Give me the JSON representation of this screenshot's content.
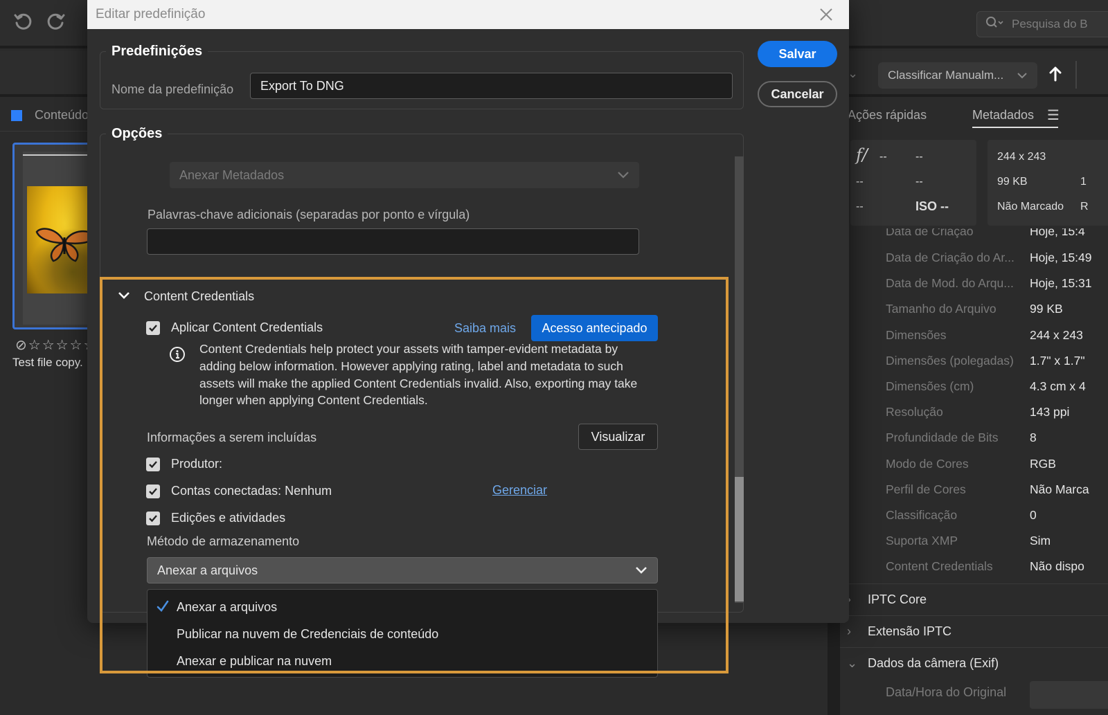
{
  "app": {
    "undo_icon": "undo-icon",
    "redo_icon": "redo-icon",
    "search_placeholder": "Pesquisa do B",
    "sort_label": "Classificar Manualm...",
    "sort_direction_icon": "arrow-up-icon",
    "left_panel": {
      "header_label": "Conteúdo",
      "thumbnail": {
        "name": "Test file copy.",
        "rating": 0,
        "rating_max": 5
      }
    },
    "right_panel": {
      "tabs": [
        {
          "label": "Ações rápidas",
          "active": false
        },
        {
          "label": "Metadados",
          "active": true
        }
      ],
      "exif_summary": {
        "fstop": "f/",
        "fstop_value": "--",
        "shutter": "--",
        "focal": "--",
        "exposure": "--",
        "flash": "--",
        "iso": "ISO --"
      },
      "file_summary": {
        "dimensions": "244 x 243",
        "size": "99 KB",
        "size_extra": "1",
        "label": "Não Marcado",
        "label_extra": "R"
      },
      "metadata_rows": [
        {
          "key": "Data de Criação",
          "value": "Hoje, 15:4"
        },
        {
          "key": "Data de Criação do Ar...",
          "value": "Hoje, 15:49"
        },
        {
          "key": "Data de Mod. do Arqu...",
          "value": "Hoje, 15:31"
        },
        {
          "key": "Tamanho do Arquivo",
          "value": "99 KB"
        },
        {
          "key": "Dimensões",
          "value": "244 x 243"
        },
        {
          "key": "Dimensões (polegadas)",
          "value": "1.7\" x 1.7\""
        },
        {
          "key": "Dimensões (cm)",
          "value": "4.3 cm x 4"
        },
        {
          "key": "Resolução",
          "value": "143 ppi"
        },
        {
          "key": "Profundidade de Bits",
          "value": "8"
        },
        {
          "key": "Modo de Cores",
          "value": "RGB"
        },
        {
          "key": "Perfil de Cores",
          "value": "Não Marca"
        },
        {
          "key": "Classificação",
          "value": "0"
        },
        {
          "key": "Suporta XMP",
          "value": "Sim"
        },
        {
          "key": "Content Credentials",
          "value": "Não dispo"
        }
      ],
      "sections": [
        {
          "label": "IPTC Core",
          "expanded": false
        },
        {
          "label": "Extensão IPTC",
          "expanded": false
        },
        {
          "label": "Dados da câmera (Exif)",
          "expanded": true
        }
      ],
      "exif_first_row": "Data/Hora do Original"
    }
  },
  "dialog": {
    "title": "Editar predefinição",
    "save_label": "Salvar",
    "cancel_label": "Cancelar",
    "presets": {
      "legend": "Predefinições",
      "name_label": "Nome da predefinição",
      "name_value": "Export To DNG"
    },
    "options": {
      "legend": "Opções",
      "metadata_select": "Anexar Metadados",
      "keywords_label": "Palavras-chave adicionais (separadas por ponto e vírgula)",
      "keywords_value": ""
    },
    "content_credentials": {
      "header": "Content Credentials",
      "apply_label": "Aplicar Content Credentials",
      "apply_checked": true,
      "learn_more": "Saiba mais",
      "early_access": "Acesso antecipado",
      "info_text": "Content Credentials help protect your assets with tamper-evident metadata by adding below information. However applying rating, label and metadata to such assets will make the applied Content Credentials invalid. Also, exporting may take longer when applying Content Credentials.",
      "include_label": "Informações a serem incluídas",
      "preview_label": "Visualizar",
      "items": [
        {
          "label": "Produtor:",
          "checked": true
        },
        {
          "label": "Contas conectadas: Nenhum",
          "checked": true
        },
        {
          "label": "Edições e atividades",
          "checked": true
        }
      ],
      "manage_link": "Gerenciar",
      "storage_label": "Método de armazenamento",
      "storage_selected": "Anexar a arquivos",
      "storage_options": [
        {
          "label": "Anexar a arquivos",
          "selected": true
        },
        {
          "label": "Publicar na nuvem de Credenciais de conteúdo",
          "selected": false
        },
        {
          "label": "Anexar e publicar na nuvem",
          "selected": false
        }
      ]
    }
  },
  "colors": {
    "accent": "#1473e6",
    "highlight": "#d8993b",
    "link": "#6fa8ea",
    "background": "#2b2b2b",
    "dialog_bg": "#2f2f2f"
  }
}
